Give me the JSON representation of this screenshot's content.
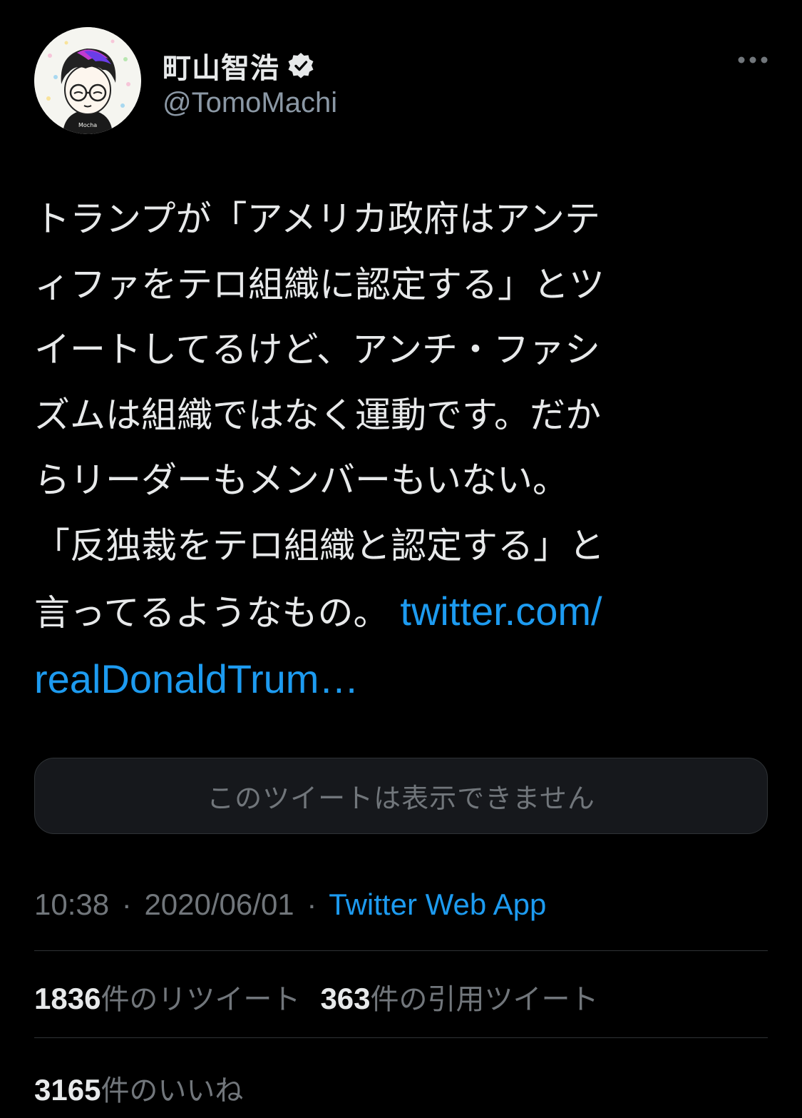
{
  "user": {
    "display_name": "町山智浩",
    "handle": "@TomoMachi",
    "verified": true,
    "avatar_text": "Mocha"
  },
  "tweet": {
    "lines": [
      "トランプが「アメリカ政府はアンテ",
      "ィファをテロ組織に認定する」とツ",
      "イートしてるけど、アンチ・ファシ",
      "ズムは組織ではなく運動です。だか",
      "らリーダーもメンバーもいない。",
      "「反独裁をテロ組織と認定する」と"
    ],
    "last_line_text": "言ってるようなもの。",
    "link_part1": "twitter.com/",
    "link_part2": "realDonaldTrum…"
  },
  "quote_card": {
    "text": "このツイートは表示できません"
  },
  "meta": {
    "time": "10:38",
    "date": "2020/06/01",
    "separator": "·",
    "source": "Twitter Web App"
  },
  "stats": {
    "retweets_count": "1836",
    "retweets_label": "件のリツイート",
    "quotes_count": "363",
    "quotes_label": "件の引用ツイート",
    "likes_count": "3165",
    "likes_label": "件のいいね"
  },
  "colors": {
    "background": "#000000",
    "text": "#e7e9ea",
    "secondary": "#71767b",
    "link": "#1d9bf0",
    "divider": "#2f3336"
  }
}
